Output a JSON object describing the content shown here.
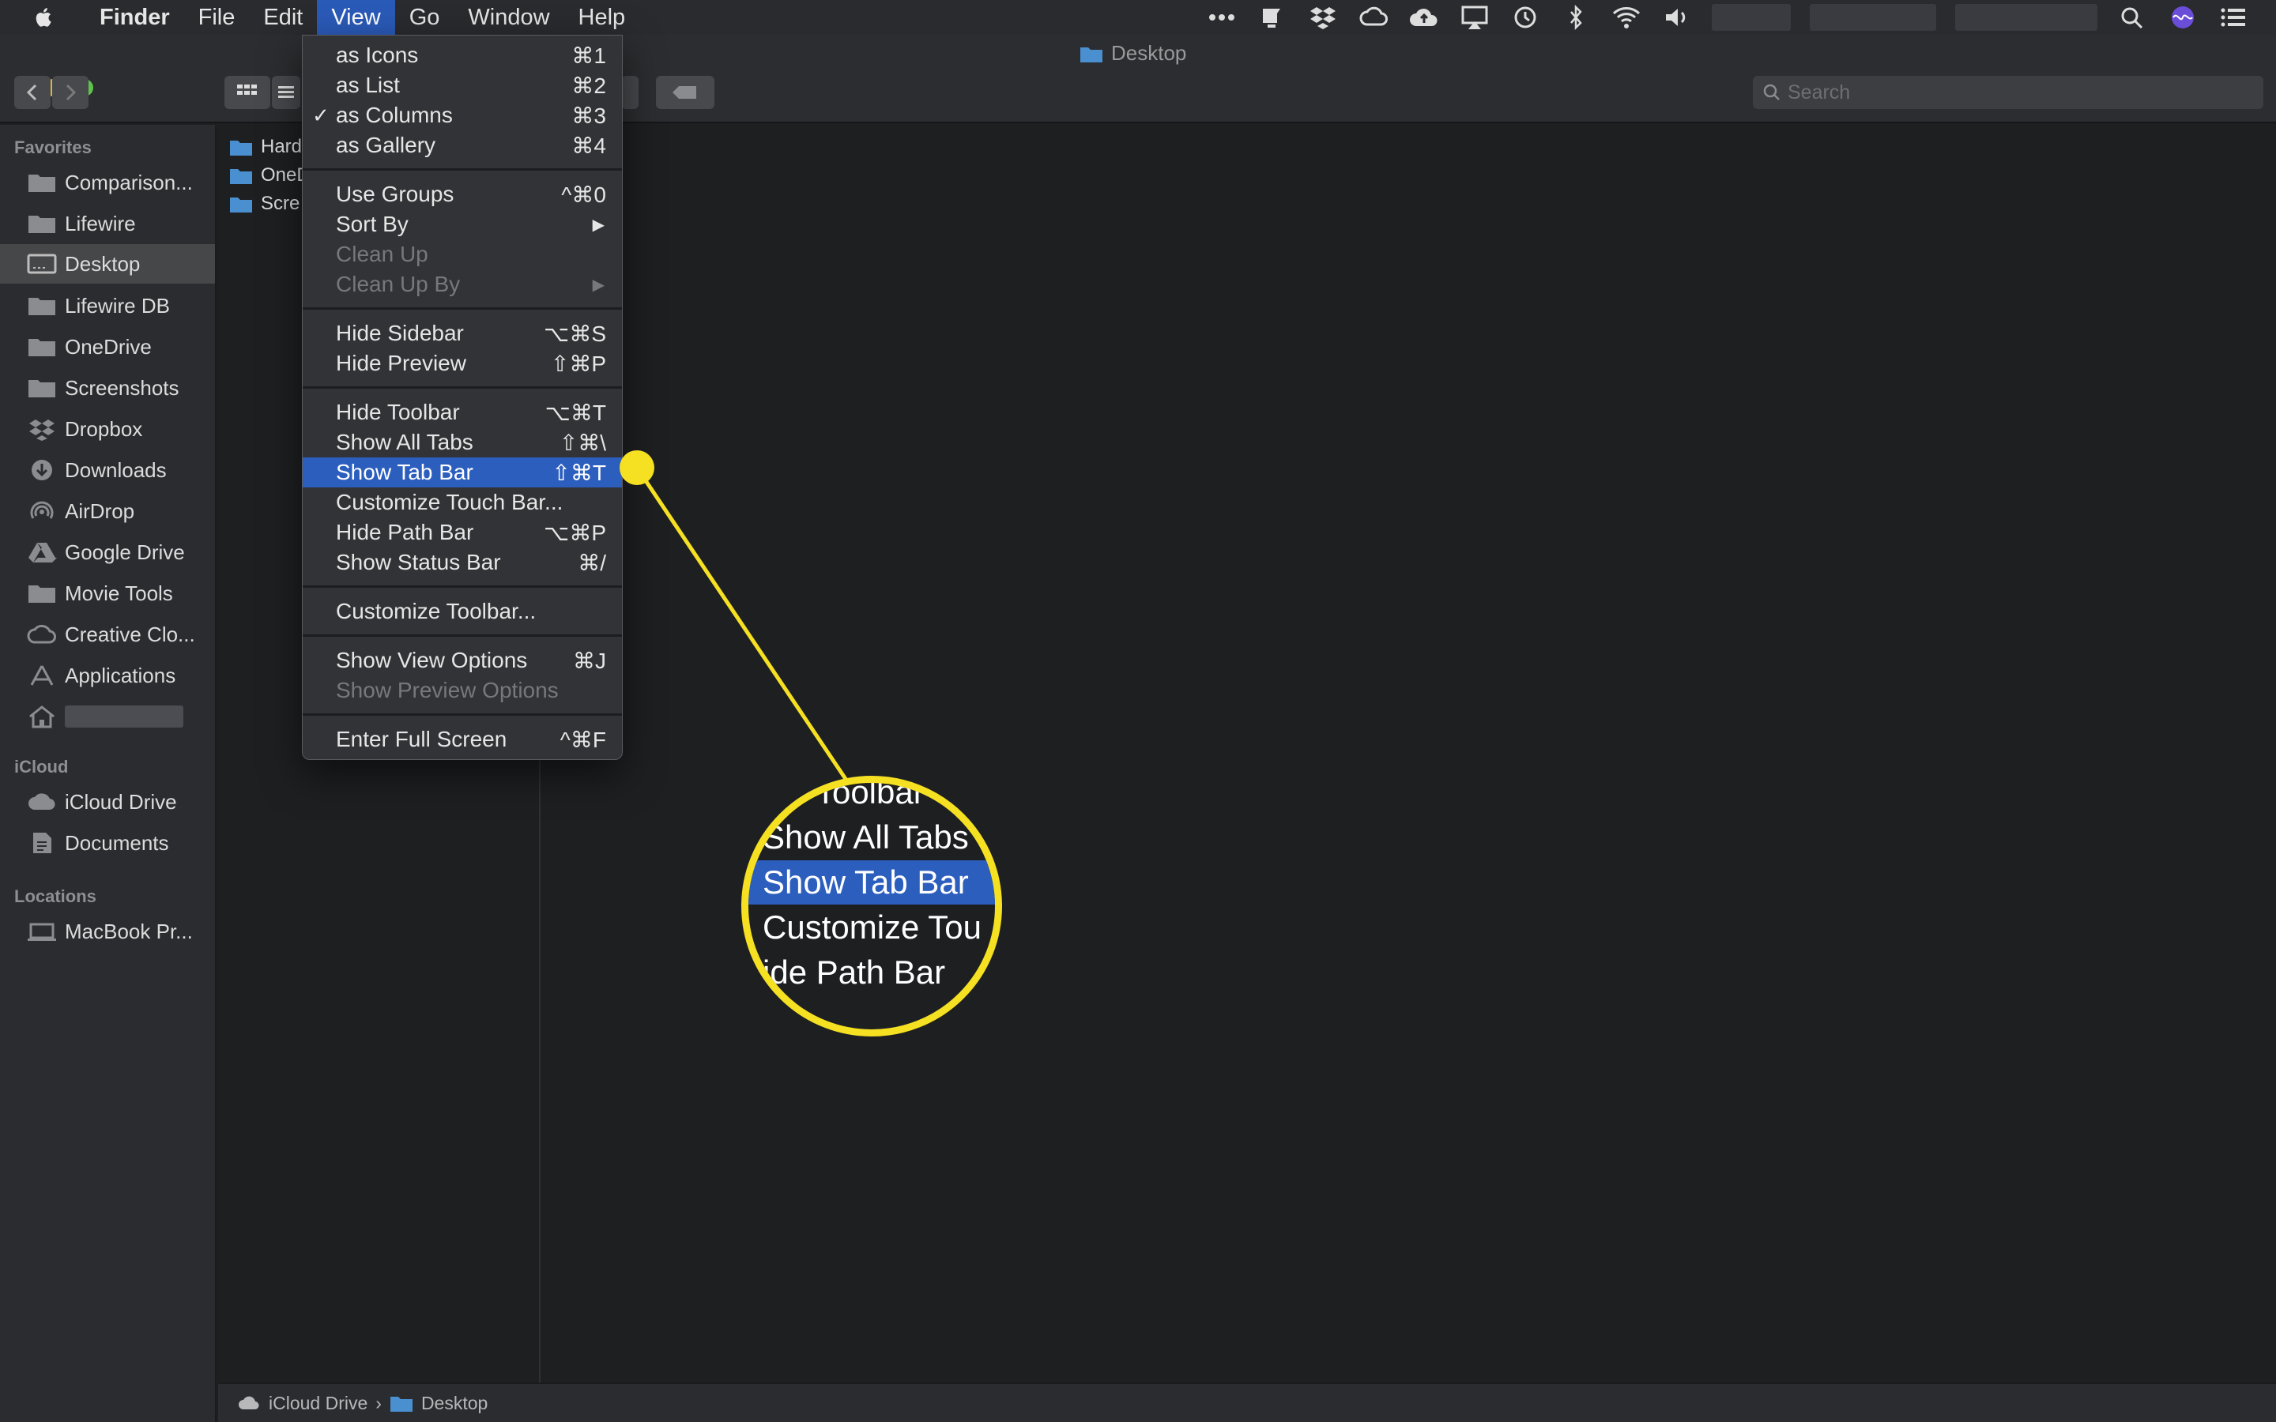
{
  "menubar": {
    "apple_icon": "apple-logo-icon",
    "app_name": "Finder",
    "items": [
      "File",
      "Edit",
      "View",
      "Go",
      "Window",
      "Help"
    ],
    "active_item": "View",
    "status_icons": [
      "more-dots-icon",
      "notification-icon",
      "dropbox-icon",
      "creative-cloud-icon",
      "cloud-upload-icon",
      "airplay-icon",
      "time-machine-icon",
      "bluetooth-icon",
      "wifi-icon",
      "volume-icon",
      "spotlight-icon",
      "siri-icon",
      "notification-center-icon"
    ]
  },
  "window": {
    "title": "Desktop",
    "search_placeholder": "Search"
  },
  "sidebar": {
    "favorites_header": "Favorites",
    "favorites": [
      {
        "label": "Comparison...",
        "icon": "folder-icon"
      },
      {
        "label": "Lifewire",
        "icon": "folder-icon"
      },
      {
        "label": "Desktop",
        "icon": "desktop-icon",
        "selected": true
      },
      {
        "label": "Lifewire DB",
        "icon": "folder-icon"
      },
      {
        "label": "OneDrive",
        "icon": "folder-icon"
      },
      {
        "label": "Screenshots",
        "icon": "folder-icon"
      },
      {
        "label": "Dropbox",
        "icon": "dropbox-icon"
      },
      {
        "label": "Downloads",
        "icon": "downloads-icon"
      },
      {
        "label": "AirDrop",
        "icon": "airdrop-icon"
      },
      {
        "label": "Google Drive",
        "icon": "google-drive-icon"
      },
      {
        "label": "Movie Tools",
        "icon": "folder-icon"
      },
      {
        "label": "Creative Clo...",
        "icon": "creative-cloud-icon"
      },
      {
        "label": "Applications",
        "icon": "applications-icon"
      }
    ],
    "icloud_header": "iCloud",
    "icloud": [
      {
        "label": "iCloud Drive",
        "icon": "icloud-icon"
      },
      {
        "label": "Documents",
        "icon": "documents-icon"
      }
    ],
    "locations_header": "Locations",
    "locations": [
      {
        "label": "MacBook Pr...",
        "icon": "laptop-icon"
      }
    ]
  },
  "column1": {
    "items": [
      "Hard",
      "OneD",
      "Scre"
    ]
  },
  "view_menu": {
    "items": [
      {
        "label": "as Icons",
        "shortcut": "⌘1"
      },
      {
        "label": "as List",
        "shortcut": "⌘2"
      },
      {
        "label": "as Columns",
        "shortcut": "⌘3",
        "checked": true
      },
      {
        "label": "as Gallery",
        "shortcut": "⌘4"
      },
      {
        "label": "Use Groups",
        "shortcut": "^⌘0"
      },
      {
        "label": "Sort By",
        "submenu": true
      },
      {
        "label": "Clean Up",
        "disabled": true
      },
      {
        "label": "Clean Up By",
        "disabled": true,
        "submenu": true
      },
      {
        "label": "Hide Sidebar",
        "shortcut": "⌥⌘S"
      },
      {
        "label": "Hide Preview",
        "shortcut": "⇧⌘P"
      },
      {
        "label": "Hide Toolbar",
        "shortcut": "⌥⌘T"
      },
      {
        "label": "Show All Tabs",
        "shortcut": "⇧⌘\\"
      },
      {
        "label": "Show Tab Bar",
        "shortcut": "⇧⌘T",
        "highlighted": true
      },
      {
        "label": "Customize Touch Bar...",
        "shortcut": ""
      },
      {
        "label": "Hide Path Bar",
        "shortcut": "⌥⌘P"
      },
      {
        "label": "Show Status Bar",
        "shortcut": "⌘/"
      },
      {
        "label": "Customize Toolbar...",
        "shortcut": ""
      },
      {
        "label": "Show View Options",
        "shortcut": "⌘J"
      },
      {
        "label": "Show Preview Options",
        "disabled": true
      },
      {
        "label": "Enter Full Screen",
        "shortcut": "^⌘F"
      }
    ],
    "checkmark": "✓",
    "submenu_arrow": "▶"
  },
  "magnifier": {
    "lines": [
      "ide Toolbar",
      "Show All Tabs",
      "Show Tab Bar",
      "Customize Tou",
      "ide Path Bar"
    ],
    "highlighted_index": 2,
    "color": "#f5e022"
  },
  "pathbar": {
    "segments": [
      "iCloud Drive",
      "Desktop"
    ],
    "separator": "›"
  },
  "colors": {
    "accent": "#2c5ebe",
    "callout": "#f5e022"
  }
}
